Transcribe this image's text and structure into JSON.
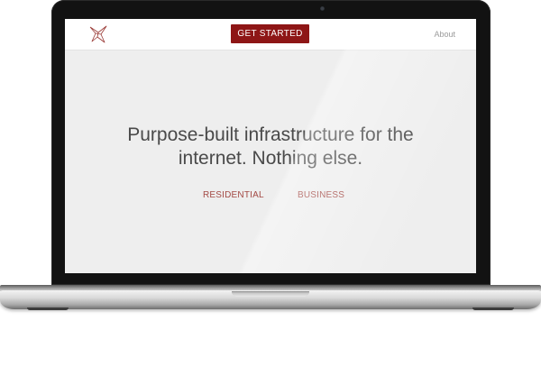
{
  "nav": {
    "cta_label": "GET STARTED",
    "about_label": "About"
  },
  "hero": {
    "headline_line1": "Purpose-built infrastructure for the",
    "headline_line2": "internet. Nothing else.",
    "link_residential": "RESIDENTIAL",
    "link_business": "BUSINESS"
  },
  "colors": {
    "brand_red": "#8e1616",
    "link_red": "#a34a45",
    "page_bg": "#eeeeee",
    "bezel": "#121212"
  },
  "icons": {
    "logo": "bird-logo-icon"
  }
}
